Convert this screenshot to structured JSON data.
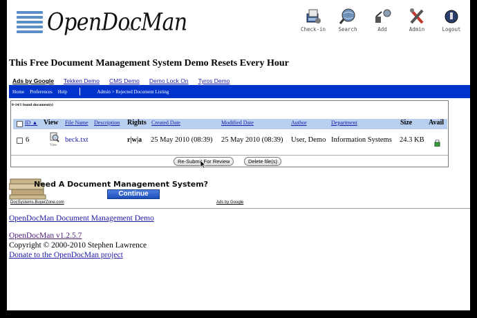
{
  "header": {
    "logo_text": "OpenDocMan",
    "logo_tm": "TM",
    "nav": [
      {
        "label": "Check-in",
        "icon": "check-in-icon"
      },
      {
        "label": "Search",
        "icon": "search-globe-icon"
      },
      {
        "label": "Add",
        "icon": "add-icon"
      },
      {
        "label": "Admin",
        "icon": "admin-tools-icon"
      },
      {
        "label": "Logout",
        "icon": "logout-icon"
      }
    ]
  },
  "banner": "This Free Document Management System Demo Resets Every Hour",
  "ads": {
    "label": "Ads by Google",
    "links": [
      "Tekken Demo",
      "CMS Demo",
      "Demo Lock On",
      "Tyros Demo"
    ]
  },
  "navbar": {
    "links": [
      "Home",
      "Preferences",
      "Help"
    ],
    "breadcrumb": "Admin > Rejected Document Listing"
  },
  "listing": {
    "found_text": "0-14/1 found document(s)",
    "columns": {
      "id": "ID",
      "view": "View",
      "file_name": "File Name",
      "description": "Description",
      "rights": "Rights",
      "created": "Created Date",
      "modified": "Modified Date",
      "author": "Author",
      "department": "Department",
      "size": "Size",
      "avail": "Avail"
    },
    "rows": [
      {
        "id": "6",
        "view_label": "View",
        "file_name": "beck.txt",
        "description": "",
        "rights": "r|w|a",
        "created": "25 May 2010 (08:39)",
        "modified": "25 May 2010 (08:39)",
        "author": "User, Demo",
        "department": "Information Systems",
        "size": "24.3 KB"
      }
    ],
    "buttons": {
      "resubmit": "Re-Submit For Review",
      "delete": "Delete file(s)"
    }
  },
  "ad_banner": {
    "headline": "Need A Document Management System?",
    "button": "Continue",
    "source": "DocSystems.BuyerZone.com",
    "ads_by": "Ads by Google"
  },
  "footer": {
    "demo_link": "OpenDocMan Document Management Demo",
    "version": "OpenDocMan v1.2.5.7",
    "copyright": "Copyright © 2000-2010 Stephen Lawrence",
    "donate": "Donate to the OpenDocMan project"
  },
  "colors": {
    "navbar": "#0033cc",
    "header_row": "#b8cff0",
    "link": "#1a1aa6",
    "visited": "#4b1a7a"
  }
}
